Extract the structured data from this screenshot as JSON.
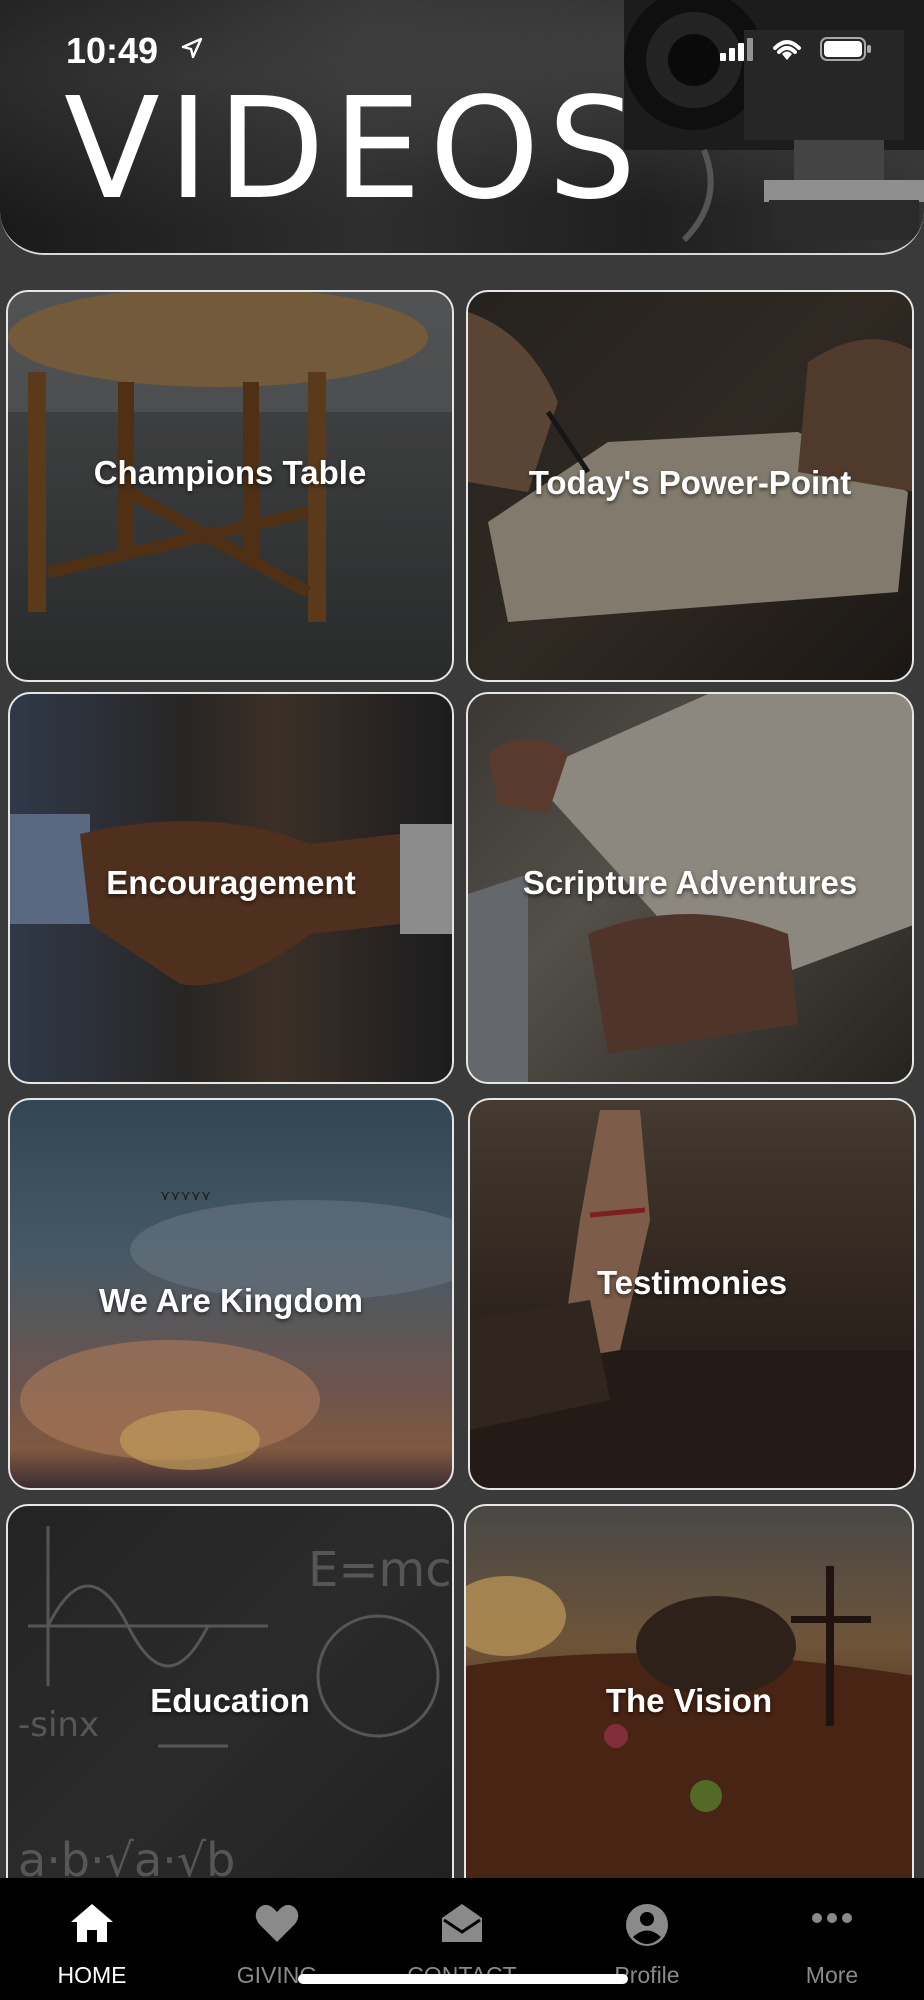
{
  "status_bar": {
    "time": "10:49"
  },
  "header": {
    "title": "VIDEOS"
  },
  "tiles": [
    {
      "label": "Champions Table"
    },
    {
      "label": "Today's Power-Point"
    },
    {
      "label": "Encouragement"
    },
    {
      "label": "Scripture Adventures"
    },
    {
      "label": "We Are Kingdom"
    },
    {
      "label": "Testimonies"
    },
    {
      "label": "Education"
    },
    {
      "label": "The Vision"
    }
  ],
  "bottom_nav": {
    "items": [
      {
        "label": "HOME",
        "icon": "home-icon"
      },
      {
        "label": "GIVING",
        "icon": "heart-icon"
      },
      {
        "label": "CONTACT",
        "icon": "envelope-open-icon"
      },
      {
        "label": "Profile",
        "icon": "user-circle-icon"
      },
      {
        "label": "More",
        "icon": "more-dots-icon"
      }
    ],
    "active_index": 0
  },
  "colors": {
    "background": "#3a3a3a",
    "nav_background": "#000000",
    "accent": "#ffffff"
  }
}
